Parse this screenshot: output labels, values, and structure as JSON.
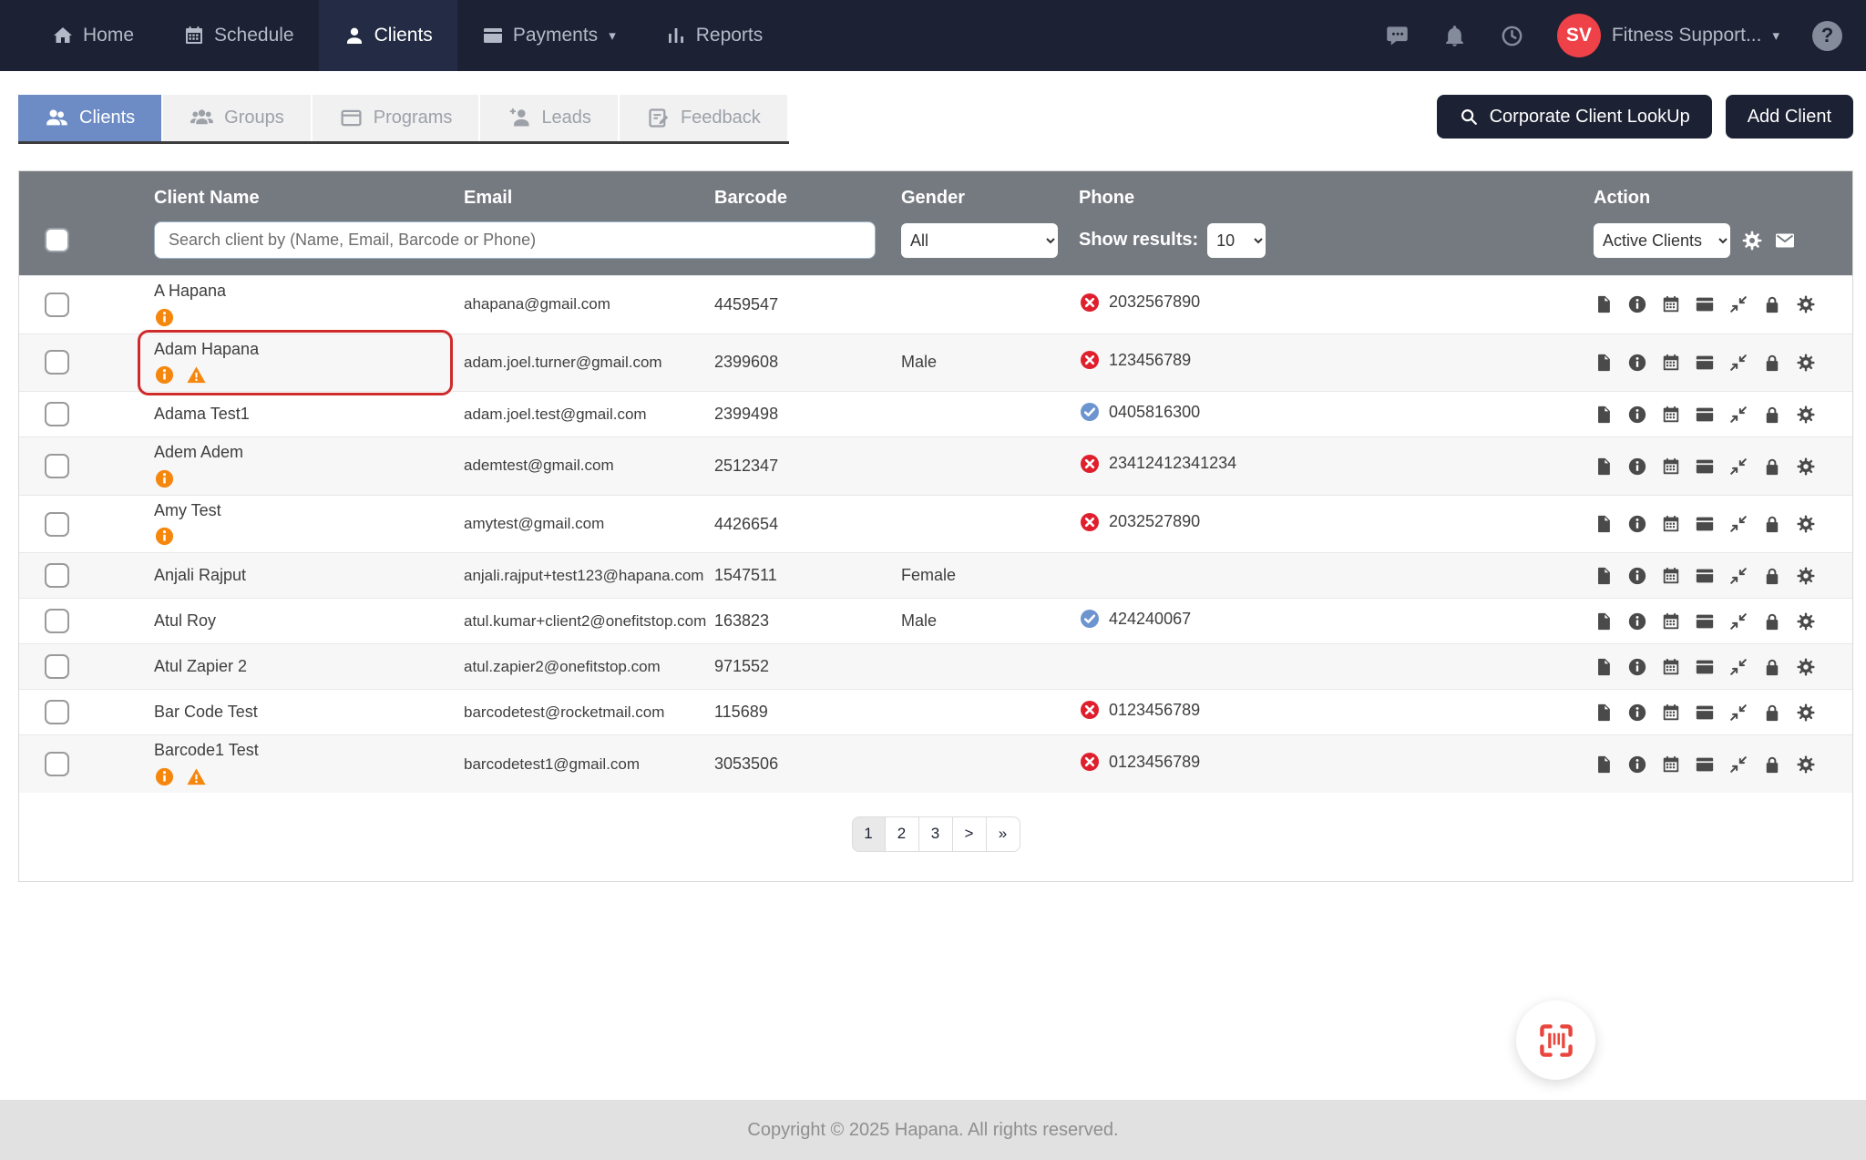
{
  "nav": {
    "items": [
      {
        "id": "home",
        "label": "Home",
        "icon": "home-icon",
        "active": false,
        "caret": false
      },
      {
        "id": "schedule",
        "label": "Schedule",
        "icon": "calendar-icon",
        "active": false,
        "caret": false
      },
      {
        "id": "clients",
        "label": "Clients",
        "icon": "user-icon",
        "active": true,
        "caret": false
      },
      {
        "id": "payments",
        "label": "Payments",
        "icon": "credit-card-icon",
        "active": false,
        "caret": true
      },
      {
        "id": "reports",
        "label": "Reports",
        "icon": "bar-chart-icon",
        "active": false,
        "caret": false
      }
    ],
    "right": {
      "icons": [
        "chat-icon",
        "bell-icon",
        "clock-icon"
      ],
      "user_initials": "SV",
      "user_name": "Fitness Support...",
      "help_glyph": "?"
    }
  },
  "tabs": [
    {
      "id": "clients",
      "label": "Clients",
      "icon": "users-icon",
      "active": true
    },
    {
      "id": "groups",
      "label": "Groups",
      "icon": "users-group-icon",
      "active": false
    },
    {
      "id": "programs",
      "label": "Programs",
      "icon": "window-icon",
      "active": false
    },
    {
      "id": "leads",
      "label": "Leads",
      "icon": "user-plus-icon",
      "active": false
    },
    {
      "id": "feedback",
      "label": "Feedback",
      "icon": "clipboard-edit-icon",
      "active": false
    }
  ],
  "buttons": {
    "corporate_label": "Corporate Client LookUp",
    "add_label": "Add Client"
  },
  "table": {
    "columns": [
      "Client Name",
      "Email",
      "Barcode",
      "Gender",
      "Phone",
      "Action"
    ],
    "search_placeholder": "Search client by (Name, Email, Barcode or Phone)",
    "gender_filter": "All",
    "show_results_label": "Show results:",
    "show_results_value": "10",
    "action_filter": "Active Clients",
    "row_actions": [
      "document",
      "info",
      "calendar",
      "credit-card",
      "compress",
      "lock",
      "gear"
    ],
    "rows": [
      {
        "name": "A Hapana",
        "flags": [
          "info"
        ],
        "email": "ahapana@gmail.com",
        "barcode": "4459547",
        "gender": "",
        "phone": "2032567890",
        "phone_status": "invalid",
        "highlight": false
      },
      {
        "name": "Adam Hapana",
        "flags": [
          "info",
          "warning"
        ],
        "email": "adam.joel.turner@gmail.com",
        "barcode": "2399608",
        "gender": "Male",
        "phone": "123456789",
        "phone_status": "invalid",
        "highlight": true
      },
      {
        "name": "Adama Test1",
        "flags": [],
        "email": "adam.joel.test@gmail.com",
        "barcode": "2399498",
        "gender": "",
        "phone": "0405816300",
        "phone_status": "valid",
        "highlight": false
      },
      {
        "name": "Adem Adem",
        "flags": [
          "info"
        ],
        "email": "ademtest@gmail.com",
        "barcode": "2512347",
        "gender": "",
        "phone": "23412412341234",
        "phone_status": "invalid",
        "highlight": false
      },
      {
        "name": "Amy Test",
        "flags": [
          "info"
        ],
        "email": "amytest@gmail.com",
        "barcode": "4426654",
        "gender": "",
        "phone": "2032527890",
        "phone_status": "invalid",
        "highlight": false
      },
      {
        "name": "Anjali Rajput",
        "flags": [],
        "email": "anjali.rajput+test123@hapana.com",
        "barcode": "1547511",
        "gender": "Female",
        "phone": "",
        "phone_status": "none",
        "highlight": false
      },
      {
        "name": "Atul Roy",
        "flags": [],
        "email": "atul.kumar+client2@onefitstop.com",
        "barcode": "163823",
        "gender": "Male",
        "phone": "424240067",
        "phone_status": "valid",
        "highlight": false
      },
      {
        "name": "Atul Zapier 2",
        "flags": [],
        "email": "atul.zapier2@onefitstop.com",
        "barcode": "971552",
        "gender": "",
        "phone": "",
        "phone_status": "none",
        "highlight": false
      },
      {
        "name": "Bar Code Test",
        "flags": [],
        "email": "barcodetest@rocketmail.com",
        "barcode": "115689",
        "gender": "",
        "phone": "0123456789",
        "phone_status": "invalid",
        "highlight": false
      },
      {
        "name": "Barcode1 Test",
        "flags": [
          "info",
          "warning"
        ],
        "email": "barcodetest1@gmail.com",
        "barcode": "3053506",
        "gender": "",
        "phone": "0123456789",
        "phone_status": "invalid",
        "highlight": false
      }
    ]
  },
  "pagination": {
    "items": [
      "1",
      "2",
      "3",
      ">",
      "»"
    ],
    "active": "1"
  },
  "footer": {
    "copyright": "Copyright © 2025 Hapana. All rights reserved."
  },
  "colors": {
    "navbar_bg": "#1c2133",
    "nav_active_bg": "#242c45",
    "active_tab_blue": "#6d8cc5",
    "table_header_gray": "#757a81",
    "avatar_red": "#ef4148",
    "flag_orange": "#f5870f",
    "phone_invalid_red": "#e01f2d",
    "phone_valid_blue": "#6c94cf",
    "highlight_red": "#cf2b2b",
    "barcode_fab_red": "#e8453c",
    "footer_bg": "#e1e1e1"
  }
}
